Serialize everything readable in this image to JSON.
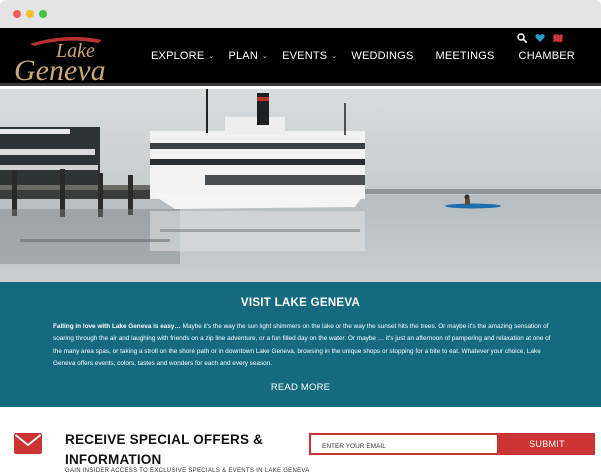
{
  "header": {
    "logo_line1": "Lake",
    "logo_line2": "Geneva",
    "nav": [
      {
        "label": "EXPLORE",
        "has_dropdown": true
      },
      {
        "label": "PLAN",
        "has_dropdown": true
      },
      {
        "label": "EVENTS",
        "has_dropdown": true
      },
      {
        "label": "WEDDINGS",
        "has_dropdown": false
      },
      {
        "label": "MEETINGS",
        "has_dropdown": false
      },
      {
        "label": "CHAMBER",
        "has_dropdown": false
      }
    ],
    "icons": [
      "search-icon",
      "heart-icon",
      "map-icon"
    ],
    "chevron": "⌄"
  },
  "visit": {
    "title": "VISIT LAKE GENEVA",
    "lead": "Falling in love with Lake Geneva is easy…",
    "body": " Maybe it's the way the sun light shimmers on the lake or the way the sunset hits the trees. Or maybe it's the amazing sensation of soaring through the air and laughing with friends on a zip line adventure, or a fun filled day on the water. Or maybe … it's just an afternoon of pampering and relaxation at one of the many area spas, or taking a stroll on the shore path or in downtown Lake Geneva, browsing in the unique shops or stopping for a bite to eat. Whatever your choice, Lake Geneva offers events, colors, tastes and wonders for each and every season.",
    "read_more": "READ MORE"
  },
  "offers": {
    "title": "RECEIVE SPECIAL OFFERS & INFORMATION",
    "subtitle": "GAIN INSIDER ACCESS TO EXCLUSIVE SPECIALS & EVENTS IN LAKE GENEVA",
    "email_placeholder": "ENTER YOUR EMAIL",
    "submit_label": "SUBMIT"
  },
  "colors": {
    "header_bg": "#000000",
    "visit_bg": "#156a80",
    "accent_red": "#cc3333",
    "logo_gold": "#c9a877",
    "heart_blue": "#2e9cc8",
    "map_red": "#d93a3a"
  }
}
